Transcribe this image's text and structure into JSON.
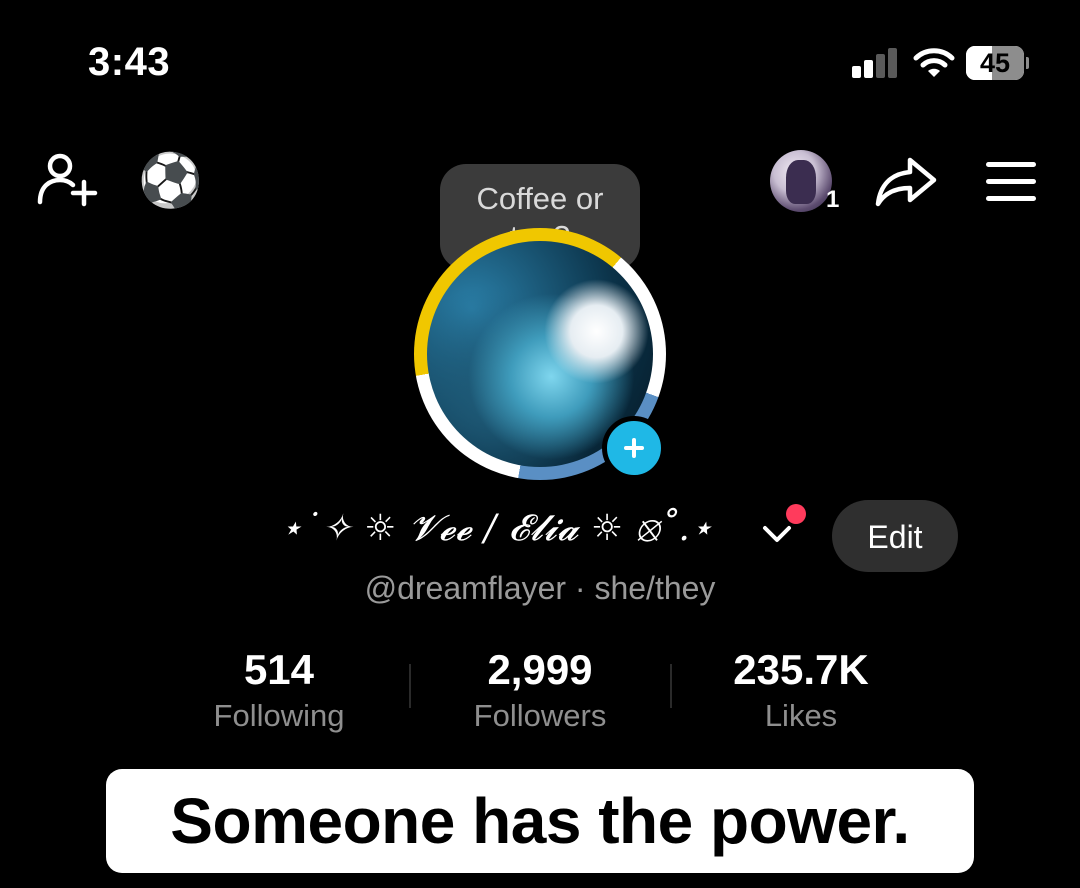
{
  "status_bar": {
    "time": "3:43",
    "battery_level": "45",
    "battery_fraction": 0.45,
    "signal_bars_active": 2,
    "signal_bars_total": 4
  },
  "nav": {
    "story_count": "1",
    "icons": [
      "add-friend-icon",
      "soccer-ball-icon",
      "share-icon",
      "menu-icon"
    ]
  },
  "profile": {
    "note_bubble": "Coffee or tea?",
    "display_name": "⋆˙✧ ☼ 𝓥𝓮𝓮 / 𝓔𝓵𝓲𝓪 ☼ ⦻˚.⋆",
    "handle_line": "@dreamflayer · she/they",
    "edit_label": "Edit"
  },
  "stats": [
    {
      "value": "514",
      "label": "Following"
    },
    {
      "value": "2,999",
      "label": "Followers"
    },
    {
      "value": "235.7K",
      "label": "Likes"
    }
  ],
  "caption": "Someone has the power.",
  "colors": {
    "background": "#000000",
    "accent_plus": "#1fb8e6",
    "notification_dot": "#ff3b5c",
    "ring_yellow": "#f0c700",
    "ring_blue": "#5a8fc4",
    "edit_bg": "#2f2f2f"
  }
}
